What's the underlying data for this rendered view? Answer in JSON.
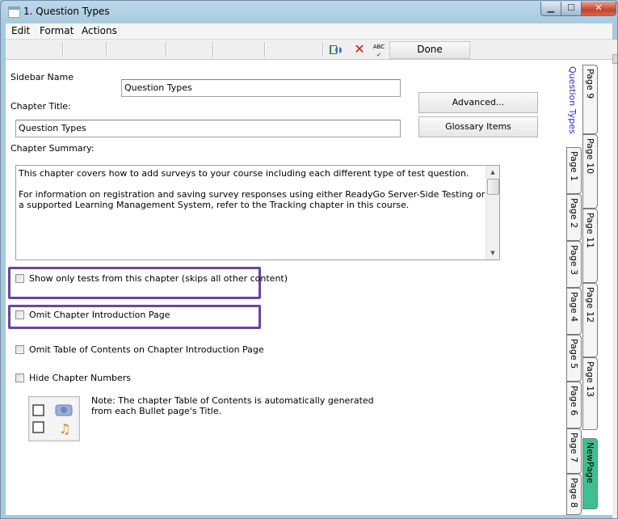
{
  "window": {
    "title": "1. Question Types"
  },
  "menu": [
    "Edit",
    "Format",
    "Actions"
  ],
  "toolbar": {
    "done_label": "Done",
    "icons": [
      "book-icon",
      "delete-x-icon",
      "spellcheck-icon"
    ],
    "spell_glyph": "ABC"
  },
  "form": {
    "sidebar_name_label": "Sidebar Name",
    "sidebar_name_value": "Question Types",
    "chapter_title_label": "Chapter Title:",
    "chapter_title_value": "Question Types",
    "advanced_label": "Advanced...",
    "glossary_label": "Glossary Items",
    "chapter_summary_label": "Chapter Summary:",
    "summary_p1": "This chapter covers how to add surveys to your course including each different type of test question.",
    "summary_p2": "For information on registration and saving survey responses using either ReadyGo Server-Side Testing or a supported Learning Management System, refer to the Tracking chapter in this course.",
    "checkboxes": [
      "Show only tests from this chapter (skips all other content)",
      "Omit Chapter Introduction Page",
      "Omit Table of Contents on Chapter Introduction Page",
      "Hide Chapter Numbers"
    ],
    "note": "Note: The chapter Table of Contents is automatically generated from each Bullet page's Title."
  },
  "right_panel": {
    "chapter_title": "Question Types",
    "tabs_col1": [
      "Page 1",
      "Page 2",
      "Page 3",
      "Page 4",
      "Page 5",
      "Page 6",
      "Page 7",
      "Page 8"
    ],
    "tabs_col2": [
      "Page 9",
      "Page 10",
      "Page 11",
      "Page 12",
      "Page 13",
      "NewPage"
    ]
  },
  "colors": {
    "highlight_box": "#6a44a6",
    "active_tab": "#3fbf8f",
    "chapter_title_text": "#2a2acc"
  }
}
